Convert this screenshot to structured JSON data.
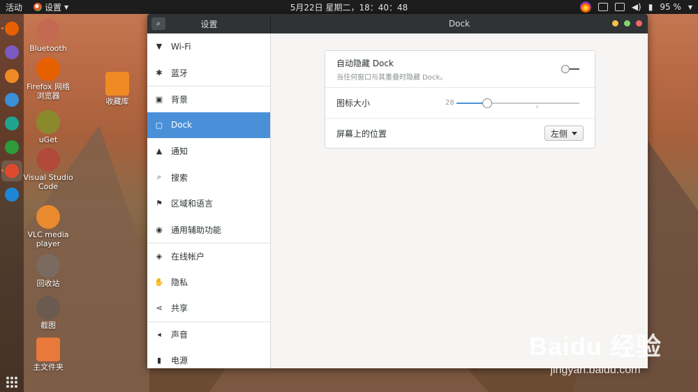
{
  "topbar": {
    "activities": "活动",
    "app_menu": "设置",
    "clock": "5月22日 星期二，18：40：48",
    "battery": "95 %"
  },
  "dock": {
    "items": [
      {
        "icon": "firefox-icon",
        "color": "#e66000"
      },
      {
        "icon": "files-icon",
        "color": "#7b5ac2"
      },
      {
        "icon": "software-icon",
        "color": "#f08a24"
      },
      {
        "icon": "help-icon",
        "color": "#3a8fd9"
      },
      {
        "icon": "system-monitor-icon",
        "color": "#1fa58f"
      },
      {
        "icon": "uget-icon",
        "color": "#2e9b3a"
      },
      {
        "icon": "settings-app-icon",
        "color": "#e04a2c"
      },
      {
        "icon": "software-updater-icon",
        "color": "#1f86d6"
      }
    ]
  },
  "desktop": {
    "icons": [
      {
        "label": "Bluetooth",
        "color": "#c46a53"
      },
      {
        "label": "Firefox 网络浏览器",
        "color": "#e66000"
      },
      {
        "label": "uGet",
        "color": "#8a8a2c"
      },
      {
        "label": "Visual Studio Code",
        "color": "#b24a3c"
      },
      {
        "label": "VLC media player",
        "color": "#e98a2e"
      },
      {
        "label": "回收站",
        "color": "#7a6a60"
      },
      {
        "label": "截图",
        "color": "#6a5a50"
      },
      {
        "label": "主文件夹",
        "color": "#e8793a"
      },
      {
        "label": "收藏库",
        "color": "#f08a24"
      }
    ]
  },
  "window": {
    "left_title": "设置",
    "title": "Dock",
    "controls": {
      "minimize": "#f4c14c",
      "maximize": "#82d56a",
      "close": "#f2656b"
    }
  },
  "sidebar": {
    "items": [
      {
        "label": "Wi-Fi",
        "icon": "wifi-icon",
        "glyph": "▼"
      },
      {
        "label": "蓝牙",
        "icon": "bluetooth-icon",
        "glyph": "✱"
      },
      {
        "label": "背景",
        "icon": "background-icon",
        "glyph": "▣"
      },
      {
        "label": "Dock",
        "icon": "dock-icon",
        "glyph": "▢"
      },
      {
        "label": "通知",
        "icon": "notifications-icon",
        "glyph": "▲"
      },
      {
        "label": "搜索",
        "icon": "search-icon",
        "glyph": "⌕"
      },
      {
        "label": "区域和语言",
        "icon": "region-language-icon",
        "glyph": "⚑"
      },
      {
        "label": "通用辅助功能",
        "icon": "accessibility-icon",
        "glyph": "◉"
      },
      {
        "label": "在线帐户",
        "icon": "online-accounts-icon",
        "glyph": "◈"
      },
      {
        "label": "隐私",
        "icon": "privacy-icon",
        "glyph": "✋"
      },
      {
        "label": "共享",
        "icon": "share-icon",
        "glyph": "⋖"
      },
      {
        "label": "声音",
        "icon": "sound-icon",
        "glyph": "◂"
      },
      {
        "label": "电源",
        "icon": "power-icon",
        "glyph": "▮"
      }
    ],
    "active_index": 3
  },
  "dock_settings": {
    "autohide": {
      "title": "自动隐藏 Dock",
      "subtitle": "当任何窗口与其重叠时隐藏 Dock。",
      "enabled": false
    },
    "icon_size": {
      "title": "图标大小",
      "value": "28",
      "fraction": 0.25
    },
    "position": {
      "title": "屏幕上的位置",
      "selected": "左侧"
    }
  },
  "watermark": {
    "line1": "Baidu 经验",
    "line2": "jingyan.baidu.com"
  }
}
